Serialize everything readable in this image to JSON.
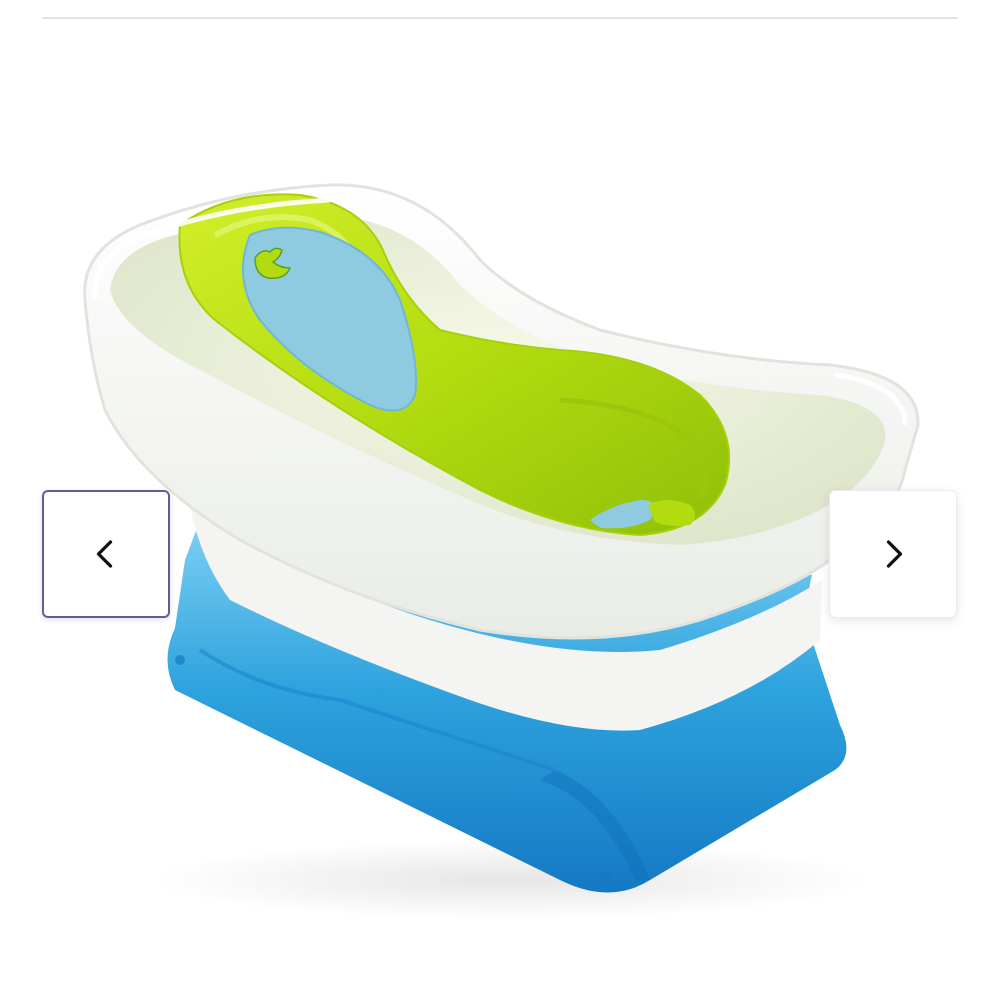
{
  "gallery": {
    "image": {
      "alt": "",
      "colors": {
        "tub": "#f4f6f1",
        "base": "#2ea3dd",
        "seat": "#b3dc10",
        "pad": "#8ecbe0"
      }
    },
    "prev_icon": "chevron-left-icon",
    "next_icon": "chevron-right-icon"
  }
}
